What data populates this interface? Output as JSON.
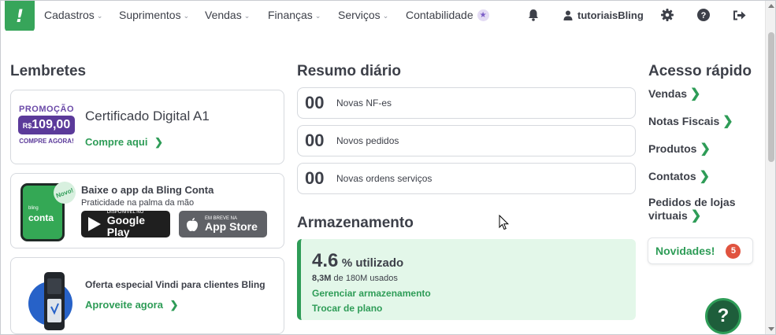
{
  "brand": {
    "logo_glyph": "!",
    "color": "#37a55a"
  },
  "nav": {
    "items": [
      {
        "label": "Cadastros"
      },
      {
        "label": "Suprimentos"
      },
      {
        "label": "Vendas"
      },
      {
        "label": "Finanças"
      },
      {
        "label": "Serviços"
      },
      {
        "label": "Contabilidade"
      }
    ],
    "user": "tutoriaisBling",
    "icons": [
      "bell-icon",
      "user-icon",
      "gear-icon",
      "help-circle-icon",
      "logout-icon"
    ]
  },
  "reminders": {
    "title": "Lembretes",
    "promo": {
      "word": "PROMOÇÃO",
      "currency": "R$",
      "price": "109,00",
      "buy": "COMPRE AGORA!",
      "title": "Certificado Digital A1",
      "link": "Compre aqui"
    },
    "app": {
      "phone_small": "bling",
      "phone_text": "conta",
      "badge": "Novo!",
      "title": "Baixe o app da Bling Conta",
      "subtitle": "Praticidade na palma da mão",
      "google_small": "DISPONÍVEL NO",
      "google_big": "Google Play",
      "apple_small": "EM BREVE NA",
      "apple_big": "App Store"
    },
    "vindi": {
      "title": "Oferta especial Vindi para clientes Bling",
      "link": "Aproveite agora"
    }
  },
  "daily": {
    "title": "Resumo diário",
    "rows": [
      {
        "count": "00",
        "label": "Novas NF-es"
      },
      {
        "count": "00",
        "label": "Novos pedidos"
      },
      {
        "count": "00",
        "label": "Novas ordens serviços"
      }
    ]
  },
  "storage": {
    "title": "Armazenamento",
    "percent": "4.6",
    "unit": "% utilizado",
    "used": "8,3M",
    "of": "de 180M usados",
    "manage": "Gerenciar armazenamento",
    "change": "Trocar de plano"
  },
  "quick": {
    "title": "Acesso rápido",
    "items": [
      {
        "label": "Vendas"
      },
      {
        "label": "Notas Fiscais"
      },
      {
        "label": "Produtos"
      },
      {
        "label": "Contatos"
      },
      {
        "label": "Pedidos de lojas virtuais"
      }
    ],
    "news_label": "Novidades!",
    "news_count": "5"
  },
  "help_glyph": "?"
}
